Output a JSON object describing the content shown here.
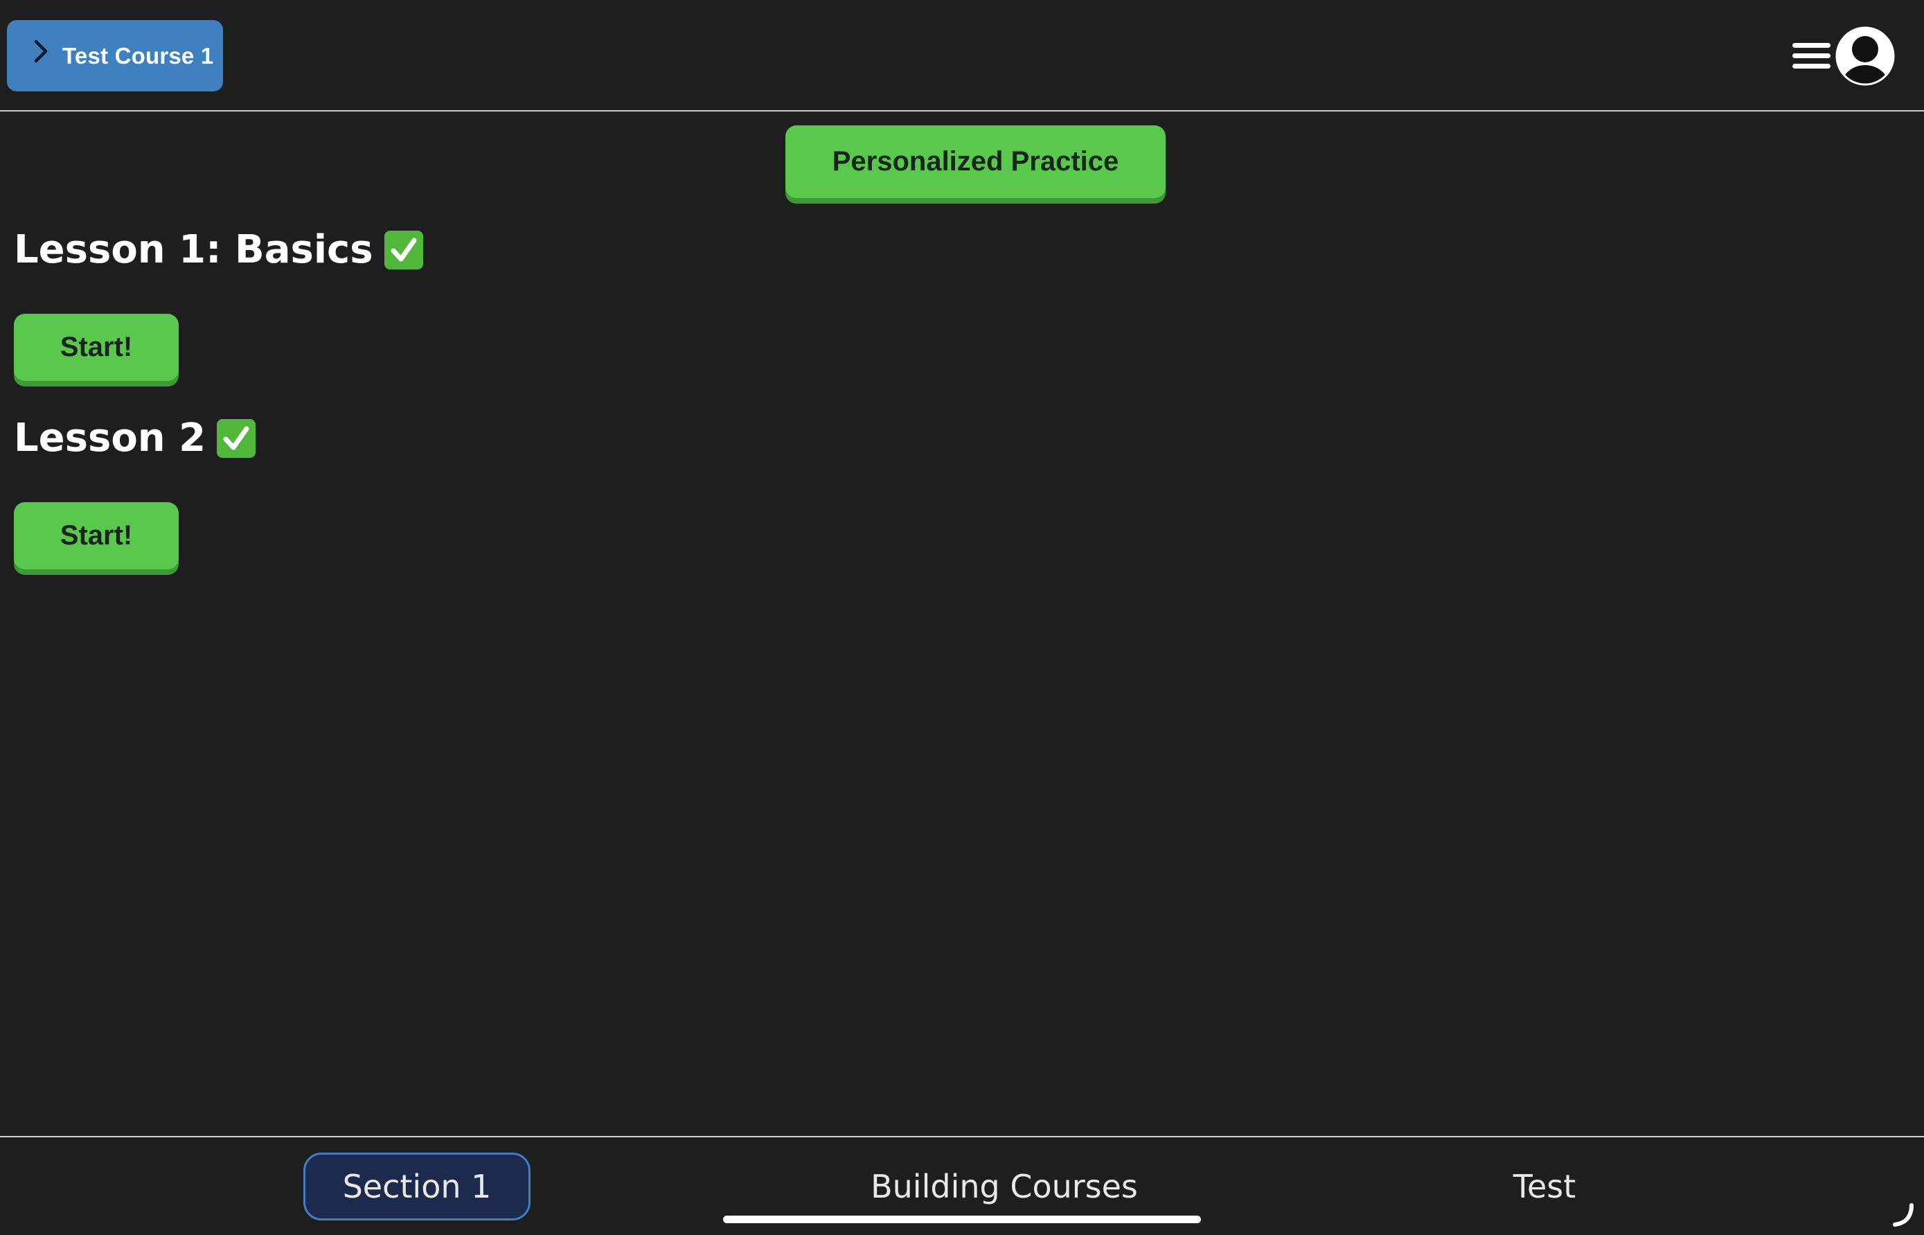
{
  "header": {
    "course_label": "Test Course 1"
  },
  "practice": {
    "label": "Personalized Practice"
  },
  "lessons": [
    {
      "title": "Lesson 1: Basics",
      "start_label": "Start!"
    },
    {
      "title": "Lesson 2",
      "start_label": "Start!"
    }
  ],
  "tabs": [
    {
      "label": "Section 1"
    },
    {
      "label": "Building Courses"
    },
    {
      "label": "Test"
    }
  ],
  "icons": {
    "course_chevron": "chevron-right-icon",
    "menu": "hamburger-menu-icon",
    "profile": "user-avatar-icon",
    "completed": "check-mark-icon"
  },
  "colors": {
    "background": "#1e1e1f",
    "course_button": "#3f80c1",
    "accent_green": "#5ac84c",
    "active_tab_bg": "#1e2a4d",
    "active_tab_border": "#3f80c1"
  }
}
